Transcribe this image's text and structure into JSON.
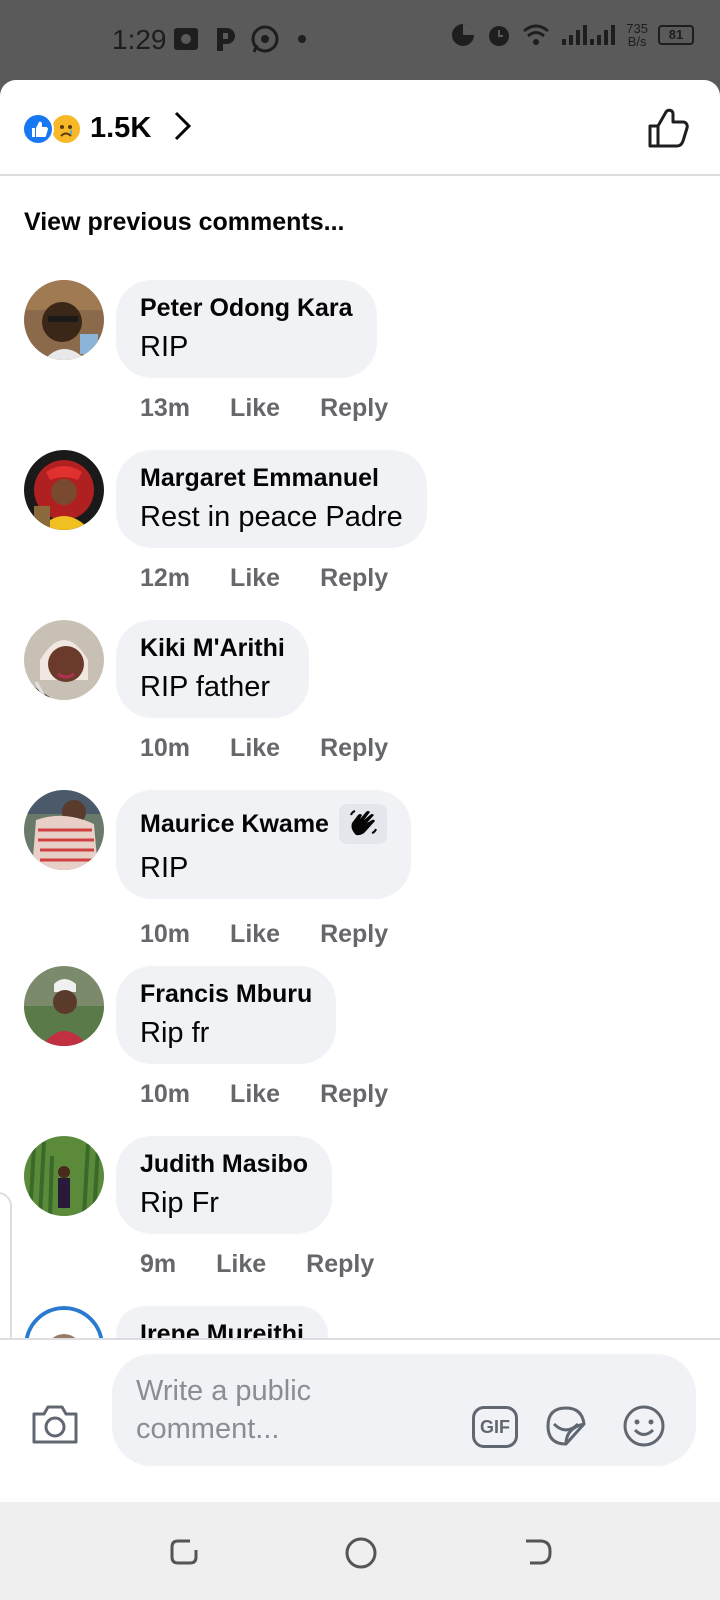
{
  "status_bar": {
    "time": "1:29",
    "net_speed_value": "735",
    "net_speed_unit": "B/s",
    "battery": "81"
  },
  "header": {
    "reaction_count": "1.5K",
    "reactions": [
      "like-reaction",
      "sad-reaction"
    ]
  },
  "view_previous": "View previous comments...",
  "comments": [
    {
      "name": "Peter Odong Kara",
      "text": "RIP",
      "time": "13m",
      "like": "Like",
      "reply": "Reply"
    },
    {
      "name": "Margaret Emmanuel",
      "text": "Rest in peace Padre",
      "time": "12m",
      "like": "Like",
      "reply": "Reply"
    },
    {
      "name": "Kiki M'Arithi",
      "text": "RIP father",
      "time": "10m",
      "like": "Like",
      "reply": "Reply"
    },
    {
      "name": "Maurice Kwame",
      "text": "RIP",
      "time": "10m",
      "like": "Like",
      "reply": "Reply",
      "badge": "waving-hand-icon"
    },
    {
      "name": "Francis Mburu",
      "text": "Rip fr",
      "time": "10m",
      "like": "Like",
      "reply": "Reply"
    },
    {
      "name": "Judith Masibo",
      "text": "Rip Fr",
      "time": "9m",
      "like": "Like",
      "reply": "Reply"
    },
    {
      "name": "Irene Mureithi",
      "text": "",
      "time": "",
      "like": "",
      "reply": ""
    }
  ],
  "composer": {
    "placeholder": "Write a public comment...",
    "gif_label": "GIF"
  },
  "colors": {
    "brand_blue": "#1877f2",
    "bubble_bg": "#f0f2f5",
    "meta_grey": "#65676b"
  }
}
